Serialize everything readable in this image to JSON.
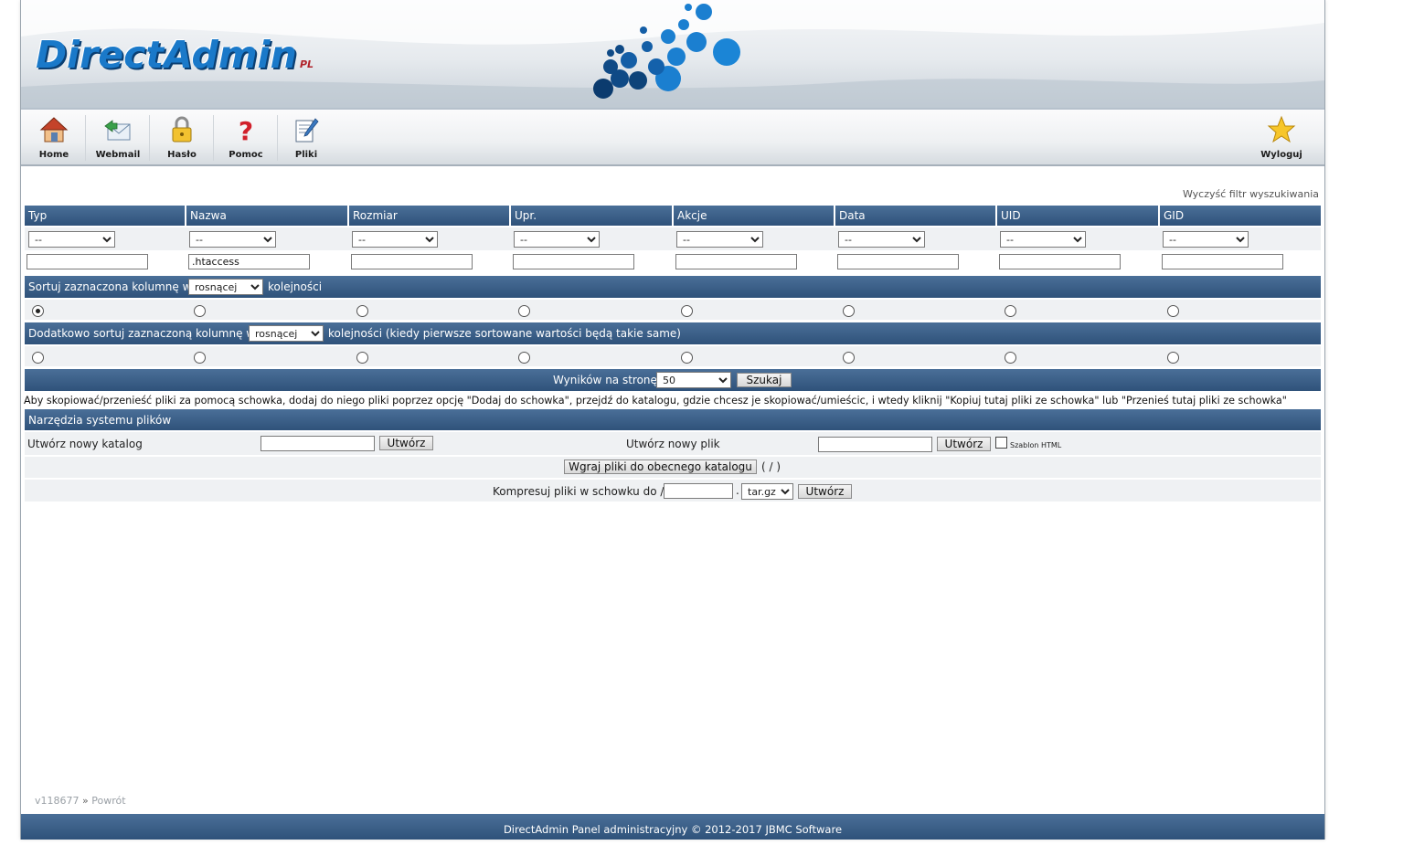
{
  "header": {
    "logo_text": "DirectAdmin",
    "logo_suffix": "PL"
  },
  "toolbar": {
    "items": [
      {
        "label": "Home",
        "icon": "home-icon"
      },
      {
        "label": "Webmail",
        "icon": "webmail-icon"
      },
      {
        "label": "Hasło",
        "icon": "lock-icon"
      },
      {
        "label": "Pomoc",
        "icon": "help-icon"
      },
      {
        "label": "Pliki",
        "icon": "files-icon"
      }
    ],
    "logout_label": "Wyloguj"
  },
  "filter": {
    "clear_label": "Wyczyść filtr wyszukiwania",
    "columns": [
      "Typ",
      "Nazwa",
      "Rozmiar",
      "Upr.",
      "Akcje",
      "Data",
      "UID",
      "GID"
    ],
    "dropdown_value": "--",
    "text_values": [
      "",
      ".htaccess",
      "",
      "",
      "",
      "",
      "",
      ""
    ]
  },
  "sort": {
    "primary_prefix": "Sortuj zaznaczona kolumnę w",
    "primary_value": "rosnącej",
    "primary_suffix": "kolejności",
    "primary_selected_index": 0,
    "secondary_prefix": "Dodatkowo sortuj zaznaczoną kolumnę w",
    "secondary_value": "rosnącej",
    "secondary_suffix": "kolejności (kiedy pierwsze sortowane wartości będą takie same)"
  },
  "results": {
    "label": "Wyników na stronę",
    "value": "50",
    "search_button": "Szukaj"
  },
  "clipboard_info": "Aby skopiować/przenieść pliki za pomocą schowka, dodaj do niego pliki poprzez opcję \"Dodaj do schowka\", przejdź do katalogu, gdzie chcesz je skopiować/umieścic, i wtedy kliknij \"Kopiuj tutaj pliki ze schowka\" lub \"Przenieś tutaj pliki ze schowka\"",
  "tools": {
    "title": "Narzędzia systemu plików",
    "new_dir_label": "Utwórz nowy katalog",
    "new_dir_button": "Utwórz",
    "new_file_label": "Utwórz nowy plik",
    "new_file_button": "Utwórz",
    "html_template_label": "Szablon HTML",
    "upload_button": "Wgraj pliki do obecnego katalogu",
    "upload_path": "( / )",
    "compress_label": "Kompresuj pliki w schowku do //",
    "compress_dot": ".",
    "compress_ext": "tar.gz",
    "compress_button": "Utwórz"
  },
  "footer": {
    "version": "v118677",
    "separator": "»",
    "back_link": "Powrót",
    "copyright": "DirectAdmin Panel administracyjny © 2012-2017 JBMC Software"
  },
  "colors": {
    "header_blue": "#2f527a",
    "logo_blue": "#1a79c9",
    "row_grey": "#eff1f3"
  }
}
